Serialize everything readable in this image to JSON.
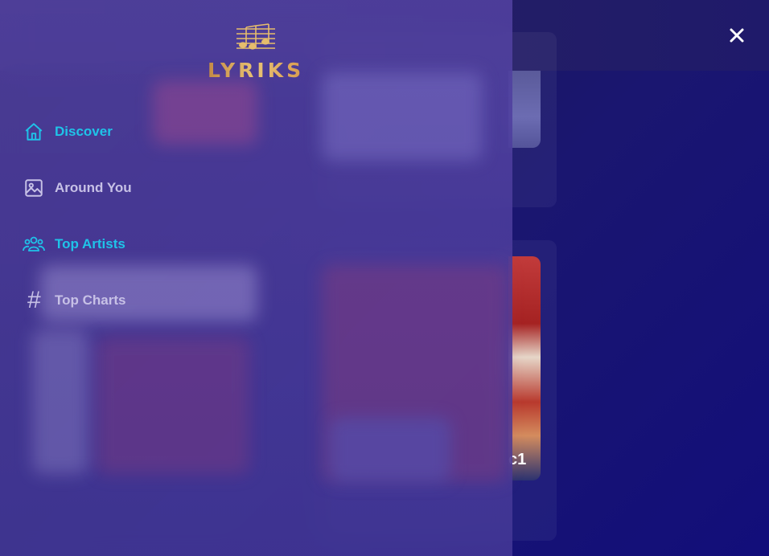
{
  "brand": {
    "name": "LYRIKS"
  },
  "nav": {
    "items": [
      {
        "label": "Discover",
        "icon": "home-icon"
      },
      {
        "label": "Around You",
        "icon": "image-icon"
      },
      {
        "label": "Top Artists",
        "icon": "users-icon"
      },
      {
        "label": "Top Charts",
        "icon": "hash-icon",
        "glyph": "#"
      }
    ]
  },
  "close": {
    "icon": "close-icon",
    "glyph": "✕"
  },
  "background": {
    "partial_card_text": "c1"
  },
  "colors": {
    "active": "#1fc3e8",
    "inactive": "#c7c1e6",
    "brand_gold": "#e0b467"
  }
}
